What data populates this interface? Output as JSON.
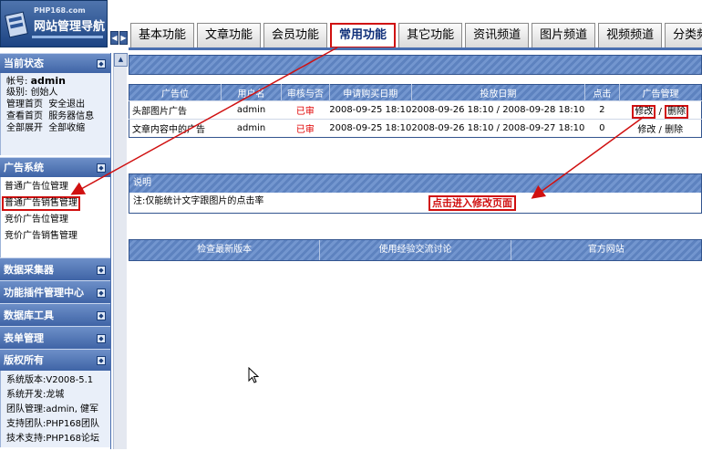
{
  "logo": {
    "site": "PHP168.com",
    "title": "网站管理导航"
  },
  "tabs": [
    {
      "label": "基本功能",
      "active": false
    },
    {
      "label": "文章功能",
      "active": false
    },
    {
      "label": "会员功能",
      "active": false
    },
    {
      "label": "常用功能",
      "active": true
    },
    {
      "label": "其它功能",
      "active": false
    },
    {
      "label": "资讯频道",
      "active": false
    },
    {
      "label": "图片频道",
      "active": false
    },
    {
      "label": "视频频道",
      "active": false
    },
    {
      "label": "分类频道",
      "active": false
    }
  ],
  "sidebar": {
    "status": {
      "title": "当前状态",
      "account_label": "帐号:",
      "account_value": "admin",
      "level": "级别: 创始人",
      "link1": "管理首页",
      "link2": "安全退出",
      "link3": "查看首页",
      "link4": "服务器信息",
      "link5": "全部展开",
      "link6": "全部收缩"
    },
    "ad": {
      "title": "广告系统",
      "items": [
        "普通广告位管理",
        "普通广告销售管理",
        "竞价广告位管理",
        "竞价广告销售管理"
      ]
    },
    "collapsed": [
      "数据采集器",
      "功能插件管理中心",
      "数据库工具",
      "表单管理"
    ],
    "copyright": {
      "title": "版权所有",
      "rows": [
        "系统版本:V2008-5.1",
        "系统开发:龙城",
        "团队管理:admin, 健军",
        "支持团队:PHP168团队",
        "技术支持:PHP168论坛"
      ]
    }
  },
  "ad_table": {
    "headers": [
      "广告位",
      "用户名",
      "审核与否",
      "申请购买日期",
      "投放日期",
      "点击",
      "广告管理"
    ],
    "rows": [
      {
        "slot": "头部图片广告",
        "user": "admin",
        "status": "已审",
        "apply": "2008-09-25 18:10",
        "period": "2008-09-26 18:10 / 2008-09-28 18:10",
        "clicks": "2",
        "edit": "修改",
        "sep": "/",
        "delete": "删除"
      },
      {
        "slot": "文章内容中的广告",
        "user": "admin",
        "status": "已审",
        "apply": "2008-09-25 18:10",
        "period": "2008-09-26 18:10 / 2008-09-27 18:10",
        "clicks": "0",
        "edit": "修改",
        "sep": "/",
        "delete": "删除"
      }
    ]
  },
  "note": {
    "title": "说明",
    "text": "注:仅能统计文字跟图片的点击率",
    "callout": "点击进入修改页面"
  },
  "links": [
    "检查最新版本",
    "使用经验交流讨论",
    "官方网站"
  ],
  "colors": {
    "accent": "#4a6fb0",
    "highlight": "#d01010",
    "approved": "#e00000"
  }
}
